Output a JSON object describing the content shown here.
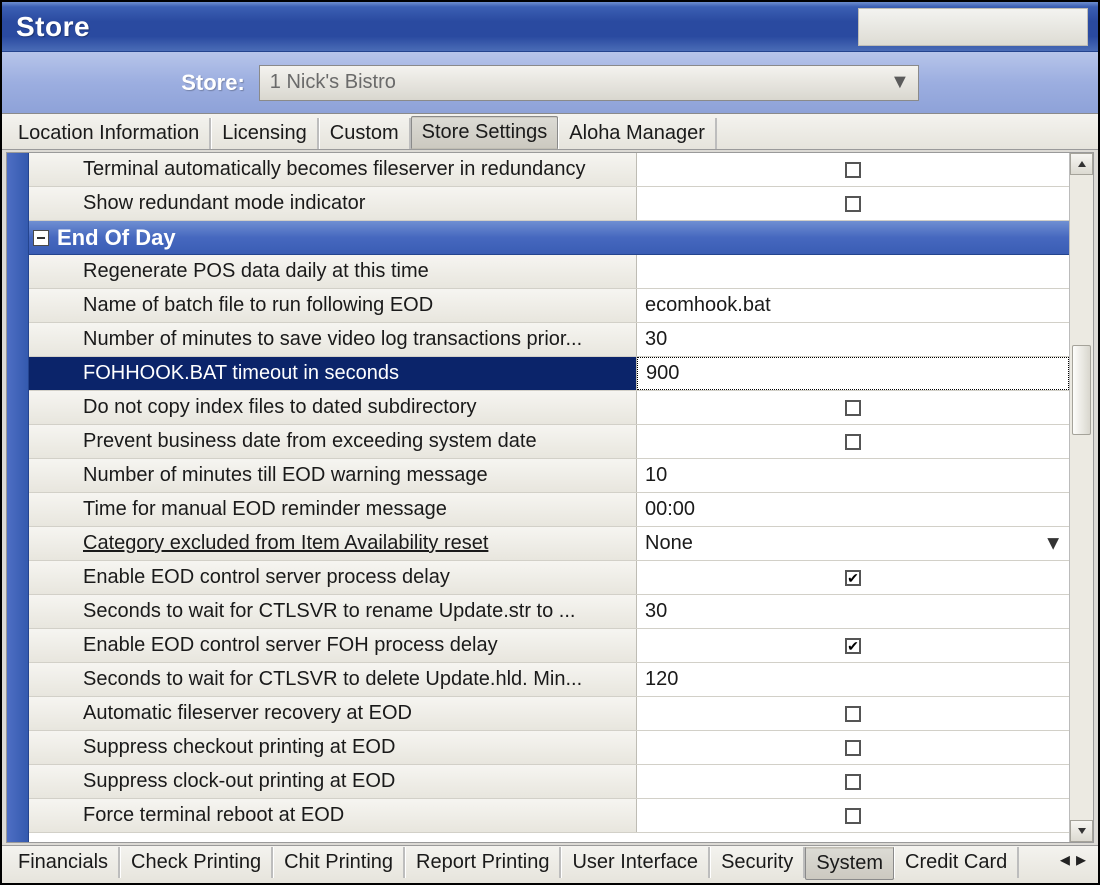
{
  "window": {
    "title": "Store"
  },
  "store_strip": {
    "label": "Store:",
    "selected": "1 Nick's Bistro"
  },
  "top_tabs": [
    {
      "label": "Location Information",
      "active": false
    },
    {
      "label": "Licensing",
      "active": false
    },
    {
      "label": "Custom",
      "active": false
    },
    {
      "label": "Store Settings",
      "active": true
    },
    {
      "label": "Aloha Manager",
      "active": false
    }
  ],
  "bottom_tabs": [
    {
      "label": "Financials",
      "active": false
    },
    {
      "label": "Check Printing",
      "active": false
    },
    {
      "label": "Chit Printing",
      "active": false
    },
    {
      "label": "Report Printing",
      "active": false
    },
    {
      "label": "User Interface",
      "active": false
    },
    {
      "label": "Security",
      "active": false
    },
    {
      "label": "System",
      "active": true
    },
    {
      "label": "Credit Card",
      "active": false
    }
  ],
  "pre_rows": [
    {
      "label": "Terminal automatically becomes fileserver in redundancy",
      "type": "check",
      "value": false
    },
    {
      "label": "Show redundant mode indicator",
      "type": "check",
      "value": false
    }
  ],
  "group": {
    "title": "End Of Day"
  },
  "rows": [
    {
      "label": "Regenerate POS data daily at this time",
      "type": "text",
      "value": ""
    },
    {
      "label": "Name of batch file to run following EOD",
      "type": "text",
      "value": "ecomhook.bat"
    },
    {
      "label": "Number of minutes to save video log transactions prior...",
      "type": "text",
      "value": "30"
    },
    {
      "label": "FOHHOOK.BAT timeout in seconds",
      "type": "text",
      "value": "900",
      "selected": true
    },
    {
      "label": "Do not copy index files to dated subdirectory",
      "type": "check",
      "value": false
    },
    {
      "label": "Prevent business date from exceeding system date",
      "type": "check",
      "value": false
    },
    {
      "label": "Number of minutes till EOD warning message",
      "type": "text",
      "value": "10"
    },
    {
      "label": "Time for manual EOD reminder message",
      "type": "text",
      "value": "00:00"
    },
    {
      "label": "Category excluded from Item Availability reset",
      "type": "select",
      "value": "None",
      "underline": true
    },
    {
      "label": "Enable EOD control server process delay",
      "type": "check",
      "value": true
    },
    {
      "label": "Seconds to wait for CTLSVR to rename Update.str to ...",
      "type": "text",
      "value": "30"
    },
    {
      "label": "Enable EOD control server FOH process delay",
      "type": "check",
      "value": true
    },
    {
      "label": "Seconds to wait for CTLSVR to delete Update.hld.  Min...",
      "type": "text",
      "value": "120"
    },
    {
      "label": "Automatic fileserver recovery at EOD",
      "type": "check",
      "value": false
    },
    {
      "label": "Suppress checkout printing at EOD",
      "type": "check",
      "value": false
    },
    {
      "label": "Suppress clock-out printing at EOD",
      "type": "check",
      "value": false
    },
    {
      "label": "Force terminal reboot at EOD",
      "type": "check",
      "value": false
    }
  ],
  "nav": {
    "left": "◂",
    "right": "▸"
  }
}
